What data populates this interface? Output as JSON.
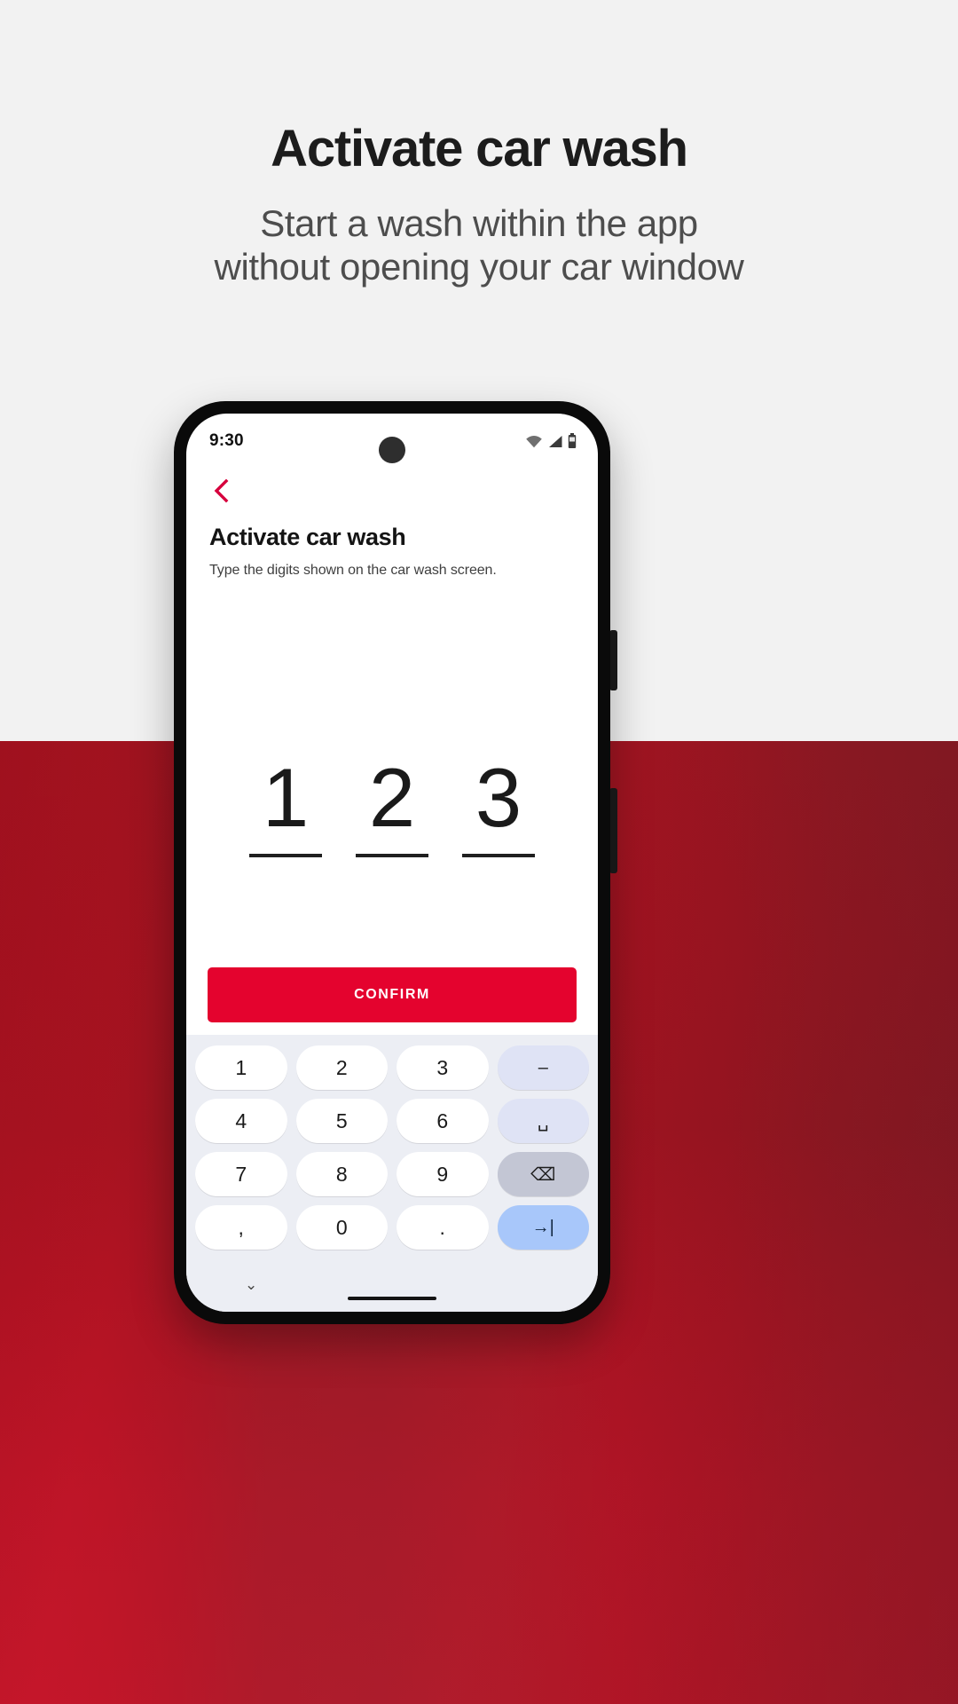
{
  "promo": {
    "title": "Activate car wash",
    "subtitle_line1": "Start a wash within the app",
    "subtitle_line2": "without opening your car window"
  },
  "colors": {
    "brand_red": "#e4032e",
    "banner_red": "#9e1622",
    "page_background": "#f2f2f2",
    "keyboard_background": "#eceef4",
    "key_accent_blue": "#a8c7fa"
  },
  "phone": {
    "statusbar": {
      "time": "9:30",
      "icons": [
        "wifi-icon",
        "cellular-signal-icon",
        "battery-icon"
      ]
    },
    "app": {
      "back_icon": "chevron-left-icon",
      "title": "Activate car wash",
      "hint": "Type the digits shown on the car wash screen.",
      "code": {
        "digits": [
          "1",
          "2",
          "3"
        ]
      },
      "confirm_label": "CONFIRM"
    },
    "keyboard": {
      "rows": [
        [
          {
            "label": "1",
            "name": "key-1",
            "style": "num"
          },
          {
            "label": "2",
            "name": "key-2",
            "style": "num"
          },
          {
            "label": "3",
            "name": "key-3",
            "style": "num"
          },
          {
            "label": "–",
            "name": "key-minus",
            "style": "fn"
          }
        ],
        [
          {
            "label": "4",
            "name": "key-4",
            "style": "num"
          },
          {
            "label": "5",
            "name": "key-5",
            "style": "num"
          },
          {
            "label": "6",
            "name": "key-6",
            "style": "num"
          },
          {
            "label": "␣",
            "name": "key-space",
            "style": "fn"
          }
        ],
        [
          {
            "label": "7",
            "name": "key-7",
            "style": "num"
          },
          {
            "label": "8",
            "name": "key-8",
            "style": "num"
          },
          {
            "label": "9",
            "name": "key-9",
            "style": "num"
          },
          {
            "label": "⌫",
            "name": "key-backspace",
            "style": "fn-dark"
          }
        ],
        [
          {
            "label": ",",
            "name": "key-comma",
            "style": "num"
          },
          {
            "label": "0",
            "name": "key-0",
            "style": "num"
          },
          {
            "label": ".",
            "name": "key-period",
            "style": "num"
          },
          {
            "label": "→|",
            "name": "key-next",
            "style": "fn-blue"
          }
        ]
      ],
      "dismiss_label": "⌄"
    }
  }
}
